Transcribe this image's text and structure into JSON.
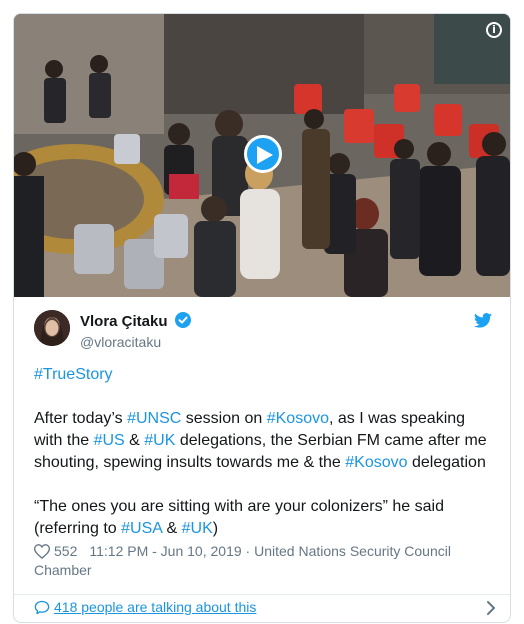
{
  "media": {
    "type": "video",
    "play_icon": "play-icon",
    "info_icon": "info-icon"
  },
  "author": {
    "name": "Vlora Çitaku",
    "handle": "@vloracitaku",
    "verified": true,
    "platform_icon": "twitter-bird-icon"
  },
  "tweet": {
    "hashtag_line": "#TrueStory",
    "para1": {
      "t1": "After today’s ",
      "h1": "#UNSC",
      "t2": " session on ",
      "h2": "#Kosovo",
      "t3": ", as I was speaking with the ",
      "h3": "#US",
      "t4": " & ",
      "h4": "#UK",
      "t5": " delegations, the Serbian FM came after me shouting, spewing insults towards me & the ",
      "h5": "#Kosovo",
      "t6": " delegation"
    },
    "para2": {
      "t1": "“The ones you are sitting with are your colonizers” he said (referring to ",
      "h1": "#USA",
      "t2": " & ",
      "h2": "#UK",
      "t3": ")"
    }
  },
  "meta": {
    "likes": "552",
    "timestamp": "11:12 PM - Jun 10, 2019",
    "separator": " · ",
    "location": "United Nations Security Council Chamber"
  },
  "footer": {
    "talking_text": "418 people are talking about this"
  },
  "colors": {
    "accent": "#1da1f2",
    "link": "#1b95e0",
    "secondary_text": "#657786"
  }
}
